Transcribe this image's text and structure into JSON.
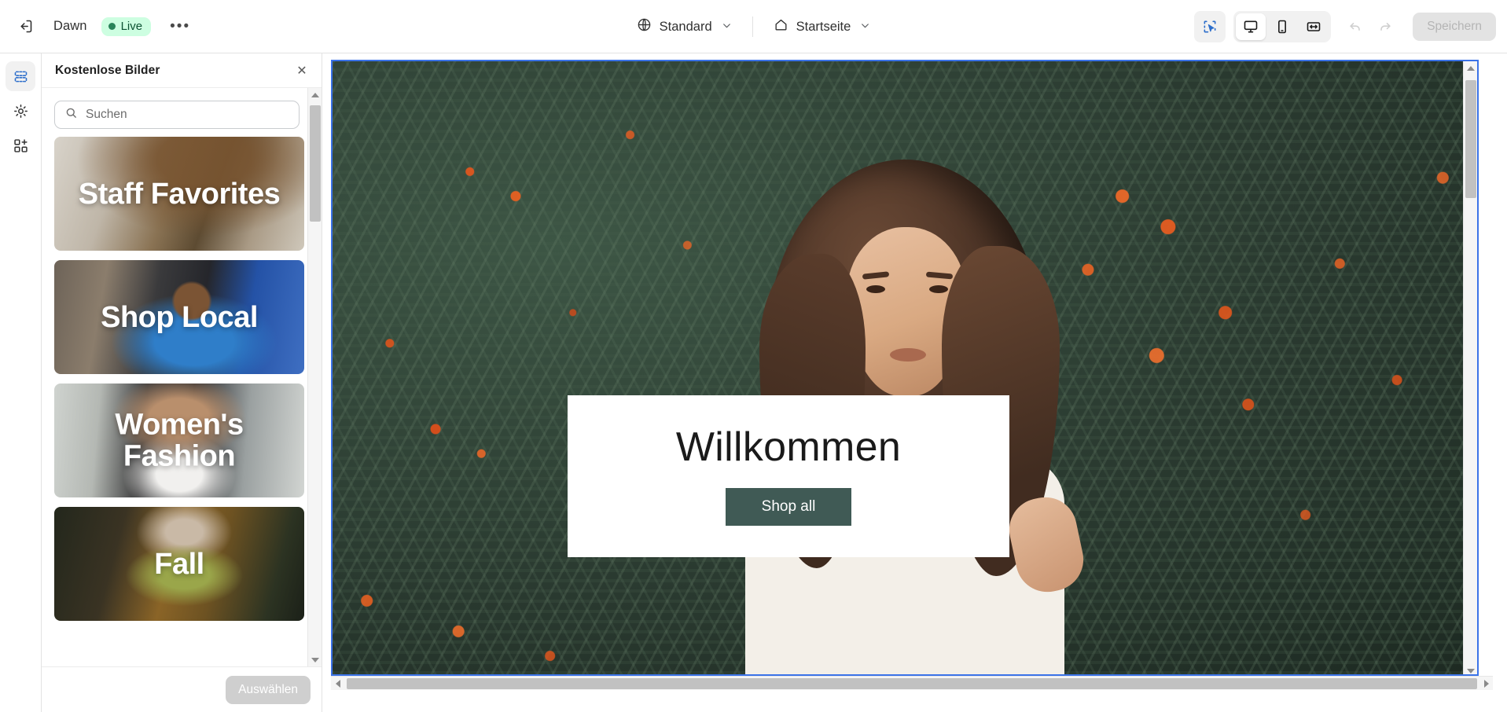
{
  "topbar": {
    "exit_icon": "exit-icon",
    "shop_name": "Dawn",
    "live_label": "Live",
    "more_label": "•••",
    "market_selector": {
      "icon": "globe-icon",
      "label": "Standard",
      "caret": "⌄"
    },
    "page_selector": {
      "icon": "home-icon",
      "label": "Startseite",
      "caret": "⌄"
    },
    "inspector_icon": "pointer-select-icon",
    "devices": [
      {
        "name": "desktop-icon",
        "selected": true
      },
      {
        "name": "mobile-icon",
        "selected": false
      },
      {
        "name": "fullwidth-icon",
        "selected": false
      }
    ],
    "undo_icon": "undo-icon",
    "redo_icon": "redo-icon",
    "save_label": "Speichern"
  },
  "rail": {
    "items": [
      {
        "name": "sections-icon",
        "active": true
      },
      {
        "name": "gear-icon",
        "active": false
      },
      {
        "name": "apps-add-icon",
        "active": false
      }
    ]
  },
  "panel": {
    "title": "Kostenlose Bilder",
    "close_label": "✕",
    "search": {
      "placeholder": "Suchen",
      "value": "",
      "icon": "search-icon"
    },
    "thumbnails": [
      {
        "label": "Staff Favorites",
        "alt": "open-books-photo"
      },
      {
        "label": "Shop Local",
        "alt": "shop-owner-photo"
      },
      {
        "label": "Women's Fashion",
        "alt": "woman-leather-jacket-photo"
      },
      {
        "label": "Fall",
        "alt": "woman-autumn-leaf-photo"
      }
    ],
    "select_button": "Auswählen"
  },
  "canvas": {
    "hero": {
      "heading": "Willkommen",
      "cta_label": "Shop all",
      "cta_color": "#405a55",
      "background_alt": "woman-in-front-of-rowan-berry-bush"
    },
    "selection_color": "#3b73e8"
  }
}
